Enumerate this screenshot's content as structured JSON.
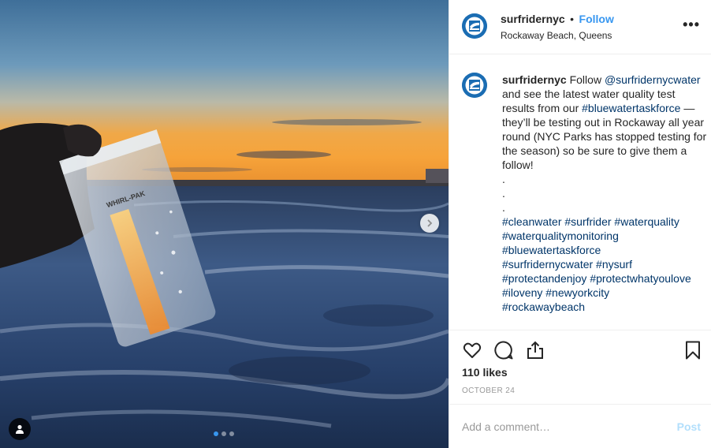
{
  "post": {
    "username": "surfridernyc",
    "separator": "•",
    "follow_label": "Follow",
    "location": "Rockaway Beach, Queens",
    "more_icon": "more-horizontal-icon",
    "more_label": "•••"
  },
  "caption": {
    "username": "surfridernyc",
    "follow_word": "Follow",
    "mention": "@surfridernycwater",
    "text_1": " and see the latest water quality test results from our ",
    "hashtag_1": "#bluewatertaskforce",
    "text_2": " — they’ll be testing out in Rockaway all year round (NYC Parks has stopped testing for the season) so be sure to give them a follow!",
    "dots": [
      ".",
      ".",
      "."
    ],
    "hashtags": [
      "#cleanwater",
      "#surfrider",
      "#waterquality",
      "#waterqualitymonitoring",
      "#bluewatertaskforce",
      "#surfridernycwater",
      "#nysurf",
      "#protectandenjoy",
      "#protectwhatyoulove",
      "#iloveny",
      "#newyorkcity",
      "#rockawaybeach"
    ]
  },
  "actions": {
    "like_icon": "heart-icon",
    "comment_icon": "comment-bubble-icon",
    "share_icon": "share-icon",
    "save_icon": "bookmark-icon",
    "likes": "110 likes",
    "date": "OCTOBER 24"
  },
  "comment_box": {
    "placeholder": "Add a comment…",
    "post_label": "Post"
  },
  "media": {
    "photo_subject": "hand holding a water sample bag over ocean at sunset",
    "bag_label": "WHIRL-PAK",
    "carousel_pages": 3,
    "carousel_current": 1
  },
  "colors": {
    "accent": "#3897f0",
    "link": "#003569",
    "brand_avatar": "#1b6db3",
    "muted": "#999999",
    "post_disabled": "#b2dffc"
  }
}
